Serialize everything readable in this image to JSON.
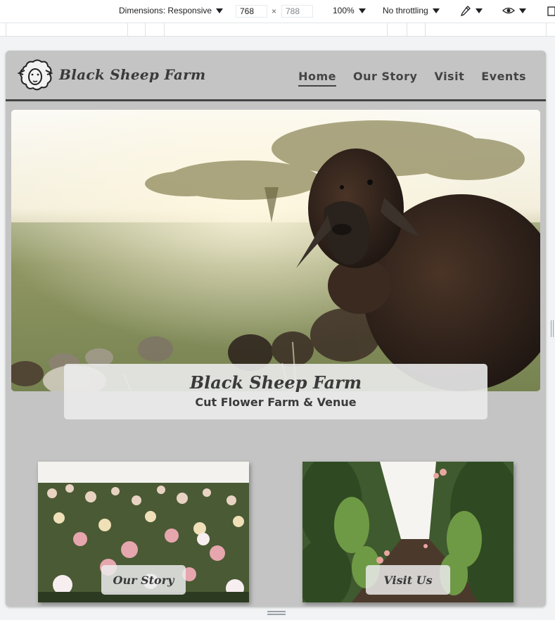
{
  "devtools": {
    "dimensions_label": "Dimensions: Responsive",
    "width_value": "768",
    "height_placeholder": "788",
    "times": "×",
    "zoom": "100%",
    "throttling": "No throttling",
    "icons": [
      "chevron-down-icon",
      "eyedropper-icon",
      "eye-icon",
      "rotate-icon"
    ]
  },
  "site": {
    "brand": "Black Sheep Farm",
    "nav": [
      {
        "label": "Home",
        "active": true
      },
      {
        "label": "Our Story",
        "active": false
      },
      {
        "label": "Visit",
        "active": false
      },
      {
        "label": "Events",
        "active": false
      }
    ],
    "hero": {
      "title": "Black Sheep Farm",
      "subtitle": "Cut Flower Farm & Venue"
    },
    "tiles": [
      {
        "button": "Our Story",
        "image": "dahlia-field"
      },
      {
        "button": "Visit Us",
        "image": "flower-row-path"
      }
    ]
  },
  "colors": {
    "page_bg": "#c4c4c4",
    "text": "#3a3a3a",
    "header_rule": "#444444"
  }
}
